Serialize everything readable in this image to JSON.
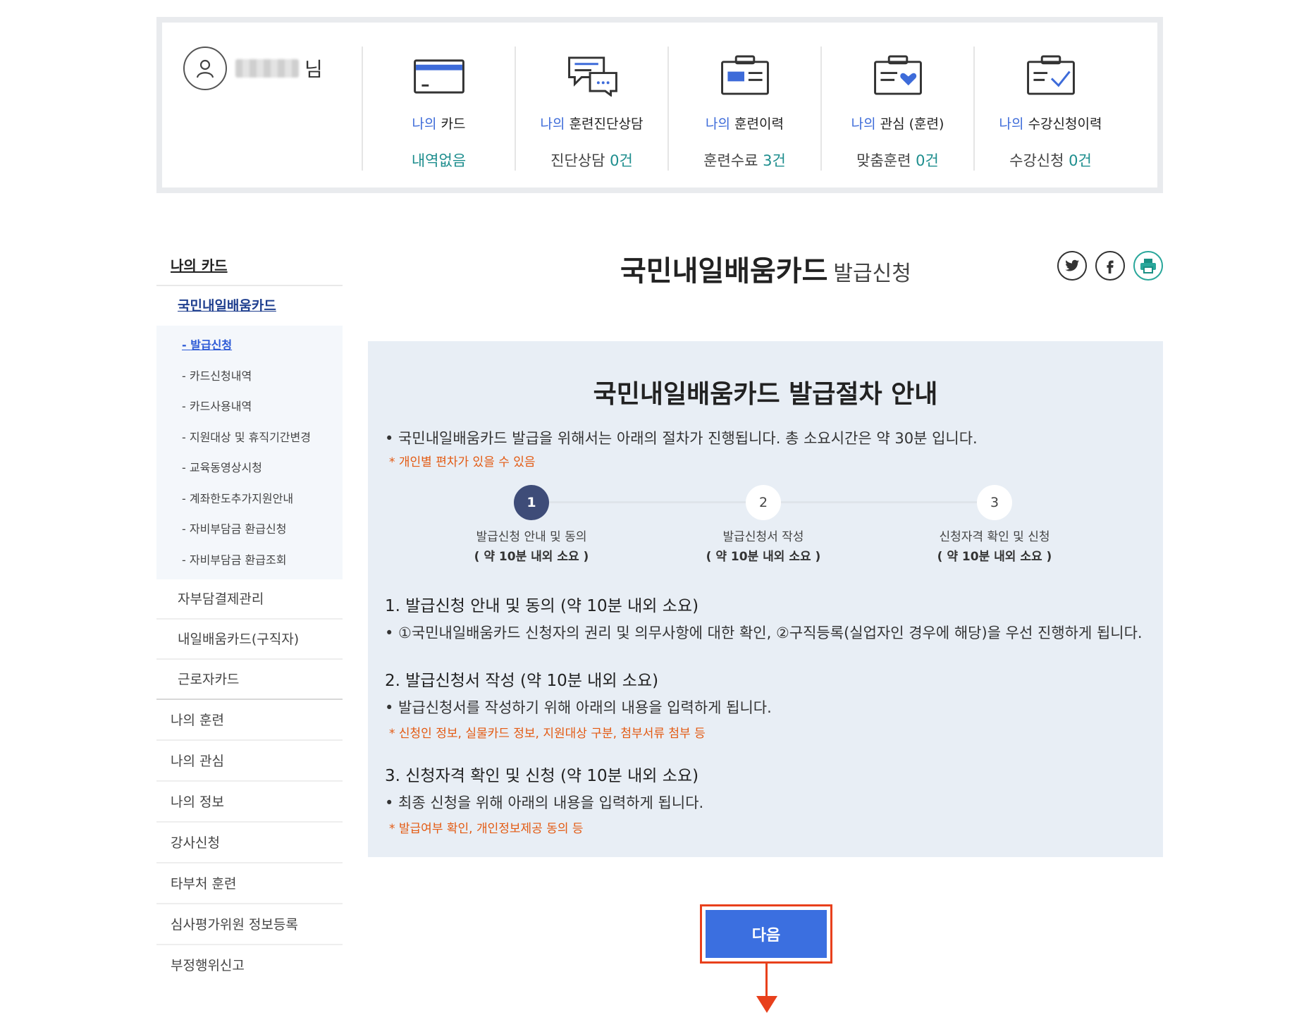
{
  "user": {
    "suffix": "님"
  },
  "stats": [
    {
      "label_pre": "나의",
      "label": "카드",
      "value": "내역없음",
      "value_num": ""
    },
    {
      "label_pre": "나의",
      "label": "훈련진단상담",
      "value": "진단상담",
      "value_num": "0건"
    },
    {
      "label_pre": "나의",
      "label": "훈련이력",
      "value": "훈련수료",
      "value_num": "3건"
    },
    {
      "label_pre": "나의",
      "label": "관심 (훈련)",
      "value": "맞춤훈련",
      "value_num": "0건"
    },
    {
      "label_pre": "나의",
      "label": "수강신청이력",
      "value": "수강신청",
      "value_num": "0건"
    }
  ],
  "lnb": {
    "title": "나의 카드",
    "sub": "국민내일배움카드",
    "deep": [
      "발급신청",
      "카드신청내역",
      "카드사용내역",
      "지원대상 및 휴직기간변경",
      "교육동영상시청",
      "계좌한도추가지원안내",
      "자비부담금 환급신청",
      "자비부담금 환급조회"
    ],
    "l2": [
      "자부담결제관리",
      "내일배움카드(구직자)",
      "근로자카드"
    ],
    "l1": [
      "나의 훈련",
      "나의 관심",
      "나의 정보",
      "강사신청",
      "타부처 훈련",
      "심사평가위원 정보등록",
      "부정행위신고"
    ]
  },
  "page_title": {
    "main": "국민내일배움카드",
    "sub": "발급신청"
  },
  "guide": {
    "title": "국민내일배움카드 발급절차 안내",
    "intro": "• 국민내일배움카드 발급을 위해서는 아래의 절차가 진행됩니다. 총 소요시간은 약 30분 입니다.",
    "intro_note": "* 개인별 편차가 있을 수 있음",
    "steps": [
      {
        "num": "1",
        "label": "발급신청 안내 및 동의",
        "time": "( 약 10분 내외 소요 )"
      },
      {
        "num": "2",
        "label": "발급신청서 작성",
        "time": "( 약 10분 내외 소요 )"
      },
      {
        "num": "3",
        "label": "신청자격 확인 및 신청",
        "time": "( 약 10분 내외 소요 )"
      }
    ],
    "sections": [
      {
        "heading": "1. 발급신청 안내 및 동의 (약 10분 내외 소요)",
        "body": "• ①국민내일배움카드 신청자의 권리 및 의무사항에 대한 확인, ②구직등록(실업자인 경우에 해당)을 우선 진행하게 됩니다.",
        "note": ""
      },
      {
        "heading": "2. 발급신청서 작성 (약 10분 내외 소요)",
        "body": "• 발급신청서를 작성하기 위해 아래의 내용을 입력하게 됩니다.",
        "note": "* 신청인 정보, 실물카드 정보, 지원대상 구분, 첨부서류 첨부 등"
      },
      {
        "heading": "3. 신청자격 확인 및 신청 (약 10분 내외 소요)",
        "body": "• 최종 신청을 위해 아래의 내용을 입력하게 됩니다.",
        "note": "* 발급여부 확인, 개인정보제공 동의 등"
      }
    ]
  },
  "next_button": "다음",
  "icons": [
    "user-icon",
    "card-icon",
    "chat-icon",
    "history-icon",
    "heart-folder-icon",
    "check-folder-icon",
    "twitter-icon",
    "facebook-icon",
    "print-icon"
  ],
  "colors": {
    "accent_blue": "#3b6fe0",
    "teal": "#1e8e8e",
    "note_orange": "#e35a12",
    "highlight_red": "#e8401c",
    "guide_bg": "#e8eef5"
  }
}
